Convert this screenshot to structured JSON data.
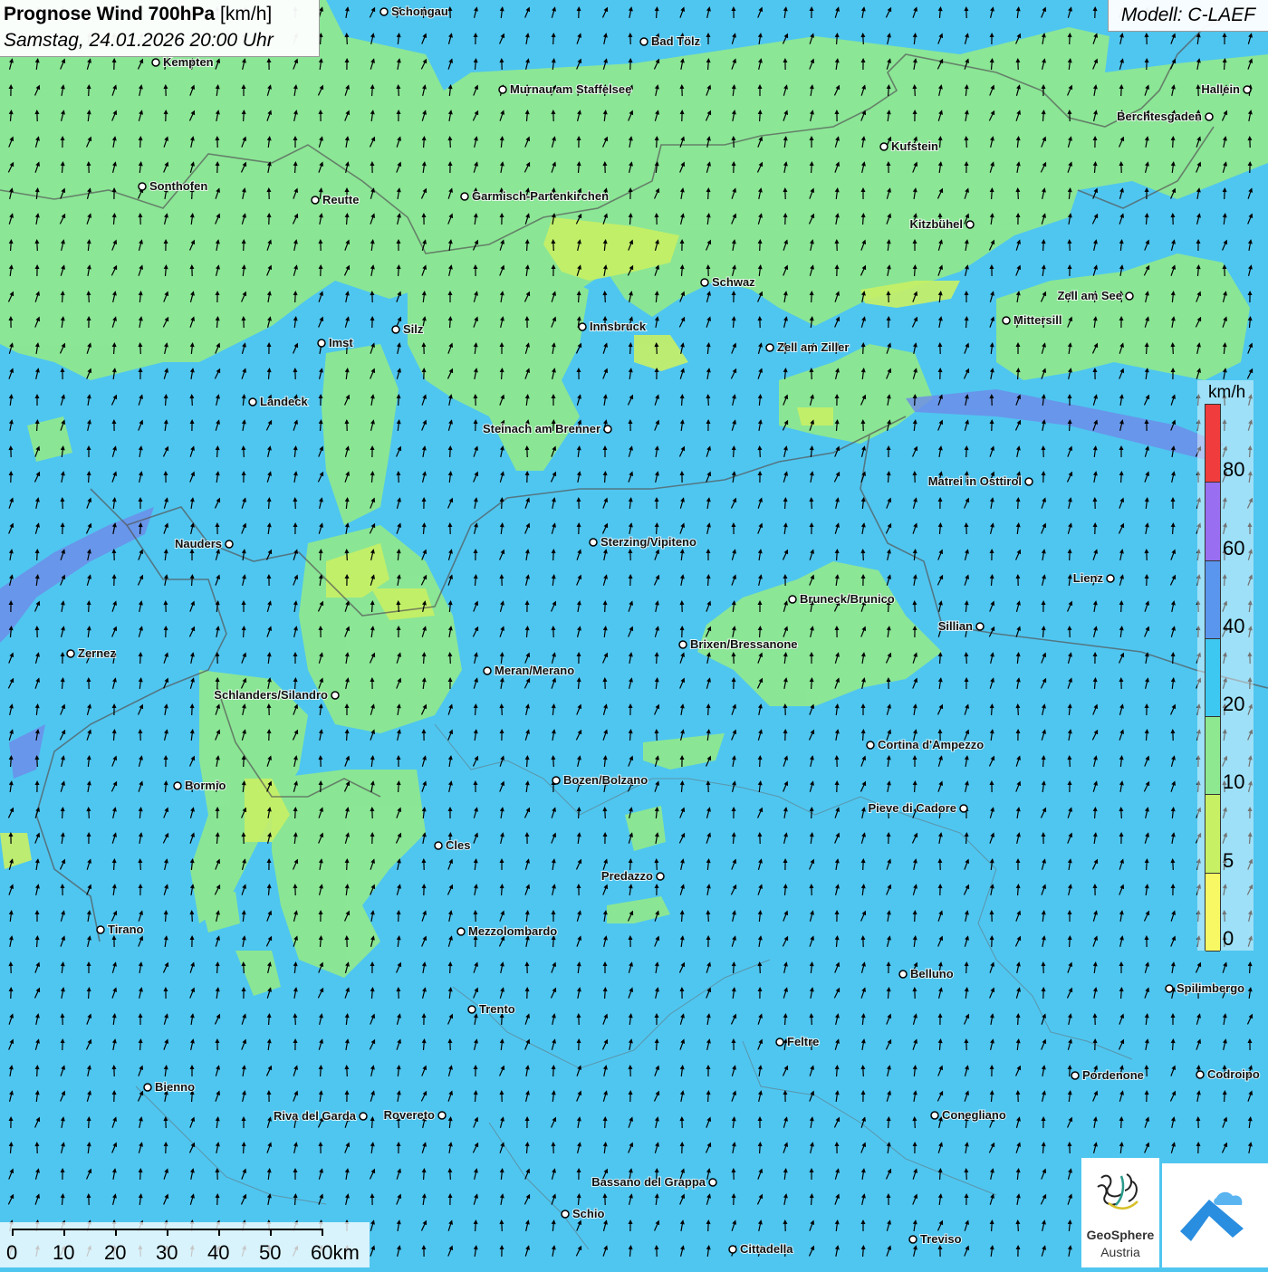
{
  "header": {
    "title_bold": "Prognose Wind 700hPa",
    "title_unit": " [km/h]",
    "datetime": "Samstag, 24.01.2026 20:00 Uhr",
    "model": "Modell: C-LAEF"
  },
  "legend": {
    "unit": "km/h",
    "classes": [
      {
        "label": "80",
        "color": "#f03c3c"
      },
      {
        "label": "60",
        "color": "#9a6ef0"
      },
      {
        "label": "40",
        "color": "#5a96ee"
      },
      {
        "label": "20",
        "color": "#3cc8f0"
      },
      {
        "label": "10",
        "color": "#8ee890"
      },
      {
        "label": "5",
        "color": "#c8f064"
      },
      {
        "label": "0",
        "color": "#f8f864"
      }
    ]
  },
  "scale": {
    "labels": [
      "0",
      "10",
      "20",
      "30",
      "40",
      "50",
      "60km"
    ]
  },
  "logo": {
    "line1": "GeoSphere",
    "line2": "Austria"
  },
  "cities": [
    {
      "name": "Schongau"
    },
    {
      "name": "Bad Tölz"
    },
    {
      "name": "Kempten"
    },
    {
      "name": "Murnau am Staffelsee"
    },
    {
      "name": "Hallein"
    },
    {
      "name": "Berchtesgaden"
    },
    {
      "name": "Kufstein"
    },
    {
      "name": "Sonthofen"
    },
    {
      "name": "Reutte"
    },
    {
      "name": "Garmisch-Partenkirchen"
    },
    {
      "name": "Kitzbühel"
    },
    {
      "name": "Schwaz"
    },
    {
      "name": "Zell am See"
    },
    {
      "name": "Mittersill"
    },
    {
      "name": "Innsbruck"
    },
    {
      "name": "Silz"
    },
    {
      "name": "Imst"
    },
    {
      "name": "Zell am Ziller"
    },
    {
      "name": "Landeck"
    },
    {
      "name": "Steinach am Brenner"
    },
    {
      "name": "Matrei in Osttirol"
    },
    {
      "name": "Nauders"
    },
    {
      "name": "Sterzing/Vipiteno"
    },
    {
      "name": "Lienz"
    },
    {
      "name": "Bruneck/Brunico"
    },
    {
      "name": "Sillian"
    },
    {
      "name": "Zernez"
    },
    {
      "name": "Brixen/Bressanone"
    },
    {
      "name": "Meran/Merano"
    },
    {
      "name": "Schlanders/Silandro"
    },
    {
      "name": "Cortina d'Ampezzo"
    },
    {
      "name": "Bozen/Bolzano"
    },
    {
      "name": "Bormio"
    },
    {
      "name": "Pieve di Cadore"
    },
    {
      "name": "Cles"
    },
    {
      "name": "Predazzo"
    },
    {
      "name": "Tirano"
    },
    {
      "name": "Mezzolombardo"
    },
    {
      "name": "Belluno"
    },
    {
      "name": "Spilimbergo"
    },
    {
      "name": "Trento"
    },
    {
      "name": "Feltre"
    },
    {
      "name": "Pordenone"
    },
    {
      "name": "Codroipo"
    },
    {
      "name": "Bienno"
    },
    {
      "name": "Riva del Garda"
    },
    {
      "name": "Rovereto"
    },
    {
      "name": "Conegliano"
    },
    {
      "name": "Bassano del Grappa"
    },
    {
      "name": "Schio"
    },
    {
      "name": "Treviso"
    },
    {
      "name": "Cittadella"
    }
  ]
}
